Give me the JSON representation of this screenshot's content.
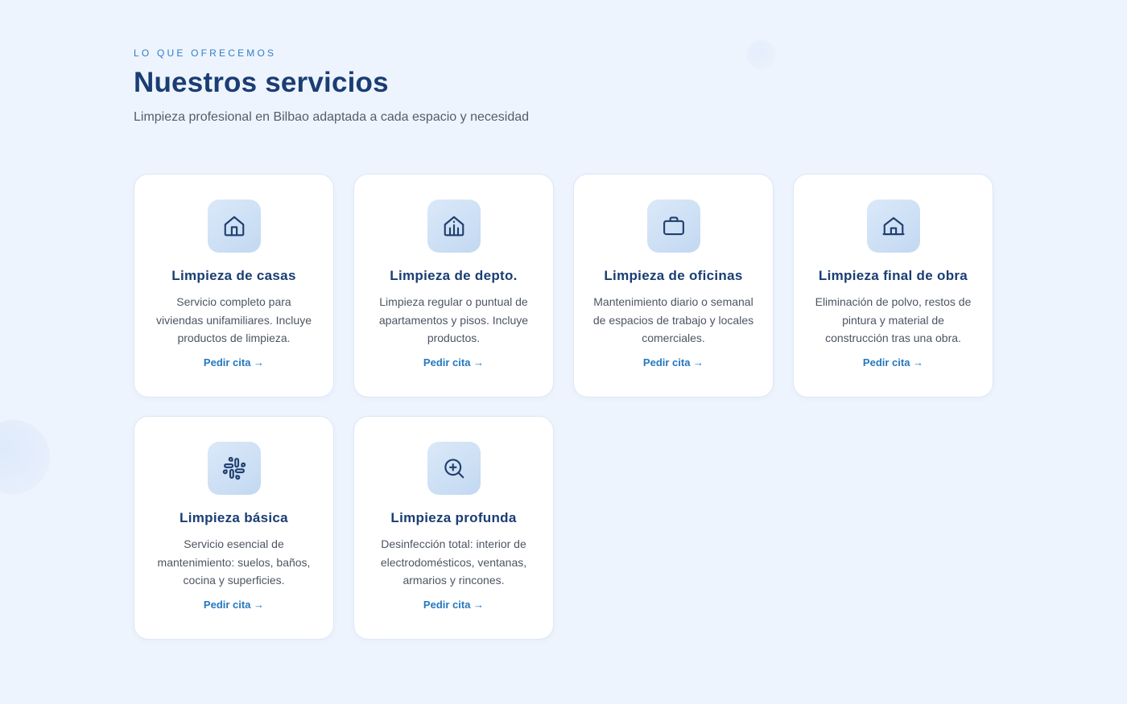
{
  "header": {
    "eyebrow": "LO QUE OFRECEMOS",
    "title": "Nuestros servicios",
    "subtitle": "Limpieza profesional en Bilbao adaptada a cada espacio y necesidad"
  },
  "link_label": "Pedir cita →",
  "colors": {
    "background": "#eef4fd",
    "heading": "#1a3d73",
    "accent": "#2478c0",
    "icon_tile": "#c9dcf3"
  },
  "services": [
    {
      "icon": "house-icon",
      "title": "Limpieza de casas",
      "description": "Servicio completo para viviendas unifamiliares. Incluye productos de limpieza.",
      "link": "Pedir cita →"
    },
    {
      "icon": "building-icon",
      "title": "Limpieza de depto.",
      "description": "Limpieza regular o puntual de apartamentos y pisos. Incluye productos.",
      "link": "Pedir cita →"
    },
    {
      "icon": "briefcase-icon",
      "title": "Limpieza de oficinas",
      "description": "Mantenimiento diario o semanal de espacios de trabajo y locales comerciales.",
      "link": "Pedir cita →"
    },
    {
      "icon": "warehouse-icon",
      "title": "Limpieza final de obra",
      "description": "Eliminación de polvo, restos de pintura y material de construcción tras una obra.",
      "link": "Pedir cita →"
    },
    {
      "icon": "slack-icon",
      "title": "Limpieza básica",
      "description": "Servicio esencial de mantenimiento: suelos, baños, cocina y superficies.",
      "link": "Pedir cita →"
    },
    {
      "icon": "zoom-in-icon",
      "title": "Limpieza profunda",
      "description": "Desinfección total: interior de electrodomésticos, ventanas, armarios y rincones.",
      "link": "Pedir cita →"
    }
  ]
}
